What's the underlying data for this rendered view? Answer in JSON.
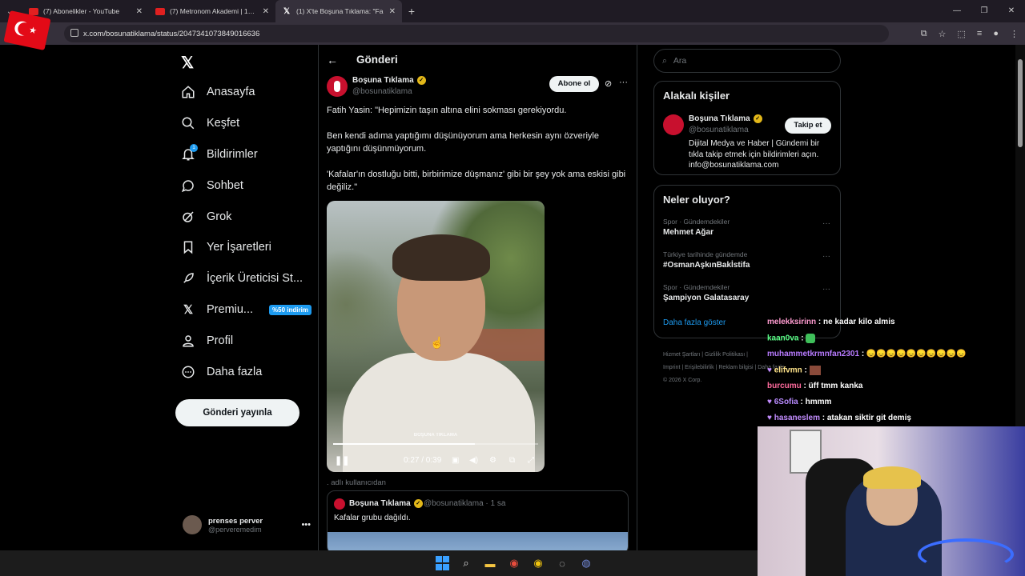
{
  "browser": {
    "tabs": [
      {
        "title": "(7) Abonelikler - YouTube",
        "icon": "youtube-icon"
      },
      {
        "title": "(7) Metronom Akademi | 19. Bö",
        "icon": "youtube-icon"
      },
      {
        "title": "(1) X'te Boşuna Tıklama: \"Fa",
        "icon": "x-icon"
      }
    ],
    "url": "x.com/bosunatiklama/status/2047341073849016636"
  },
  "nav": {
    "items": [
      {
        "label": "Anasayfa",
        "icon": "home-icon"
      },
      {
        "label": "Keşfet",
        "icon": "search-icon"
      },
      {
        "label": "Bildirimler",
        "icon": "bell-icon",
        "badge": "1"
      },
      {
        "label": "Sohbet",
        "icon": "chat-icon"
      },
      {
        "label": "Grok",
        "icon": "grok-icon"
      },
      {
        "label": "Yer İşaretleri",
        "icon": "bookmark-icon"
      },
      {
        "label": "İçerik Üreticisi St...",
        "icon": "rocket-icon"
      },
      {
        "label": "Premiu...",
        "icon": "x-icon",
        "tag": "%50 indirim"
      },
      {
        "label": "Profil",
        "icon": "person-icon"
      },
      {
        "label": "Daha fazla",
        "icon": "more-circle-icon"
      }
    ],
    "post_button": "Gönderi yayınla",
    "account": {
      "name": "prenses perver",
      "handle": "@perveremedim"
    }
  },
  "post": {
    "header_title": "Gönderi",
    "author": {
      "name": "Boşuna Tıklama",
      "handle": "@bosunatiklama"
    },
    "subscribe_label": "Abone ol",
    "paragraphs": [
      "Fatih Yasin: \"Hepimizin taşın altına elini sokması gerekiyordu.",
      "Ben kendi adıma yaptığımı düşünüyorum ama herkesin aynı özveriyle yaptığını düşünmüyorum.",
      "'Kafalar'ın dostluğu bitti, birbirimize düşmanız' gibi bir şey yok ama eskisi gibi değiliz.\""
    ],
    "video": {
      "time": "0:27 / 0:39",
      "progress": 0.69,
      "watermark": "BOŞUNA TIKLAMA"
    },
    "via": ". adlı kullanıcıdan",
    "quote": {
      "name": "Boşuna Tıklama",
      "handle": "@bosunatiklama · 1 sa",
      "text": "Kafalar grubu dağıldı."
    }
  },
  "sidebar": {
    "search_placeholder": "Ara",
    "related": {
      "title": "Alakalı kişiler",
      "name": "Boşuna Tıklama",
      "handle": "@bosunatiklama",
      "follow_label": "Takip et",
      "bio": "Dijital Medya ve Haber | Gündemi bir tıkla takip etmek için bildirimleri açın. info@bosunatiklama.com"
    },
    "trends": {
      "title": "Neler oluyor?",
      "items": [
        {
          "meta": "Spor · Gündemdekiler",
          "name": "Mehmet Ağar"
        },
        {
          "meta": "Türkiye tarihinde gündemde",
          "name": "#OsmanAşkınBakİstifa"
        },
        {
          "meta": "Spor · Gündemdekiler",
          "name": "Şampiyon Galatasaray"
        }
      ],
      "show_more": "Daha fazla göster"
    },
    "footer": {
      "line1": "Hizmet Şartları  |  Gizlilik Politikası  |",
      "line2": "Imprint  |  Erişilebilirlik  |  Reklam bilgisi  |  Daha fazla ...",
      "line3": "© 2026 X Corp."
    }
  },
  "chat": [
    {
      "user": "melekksirinn",
      "msg": " : ne kadar kilo almis",
      "color": "#ff9bd0"
    },
    {
      "user": "kaan0va",
      "msg": " :",
      "color": "#5bff88"
    },
    {
      "user": "muhammetkrmnfan2301",
      "msg": " : 😞😞😞😞😞😞😞😞😞😞",
      "color": "#b87bff"
    },
    {
      "user": "elifvmn",
      "msg": " :",
      "color": "#ffe48a"
    },
    {
      "user": "burcumu",
      "msg": " : üff tmm kanka",
      "color": "#ff6b9d"
    },
    {
      "user": "6Sofia",
      "msg": " : hmmm",
      "color": "#b98bff"
    },
    {
      "user": "hasaneslem",
      "msg": " : atakan siktir git demiş",
      "color": "#c38dff"
    }
  ]
}
